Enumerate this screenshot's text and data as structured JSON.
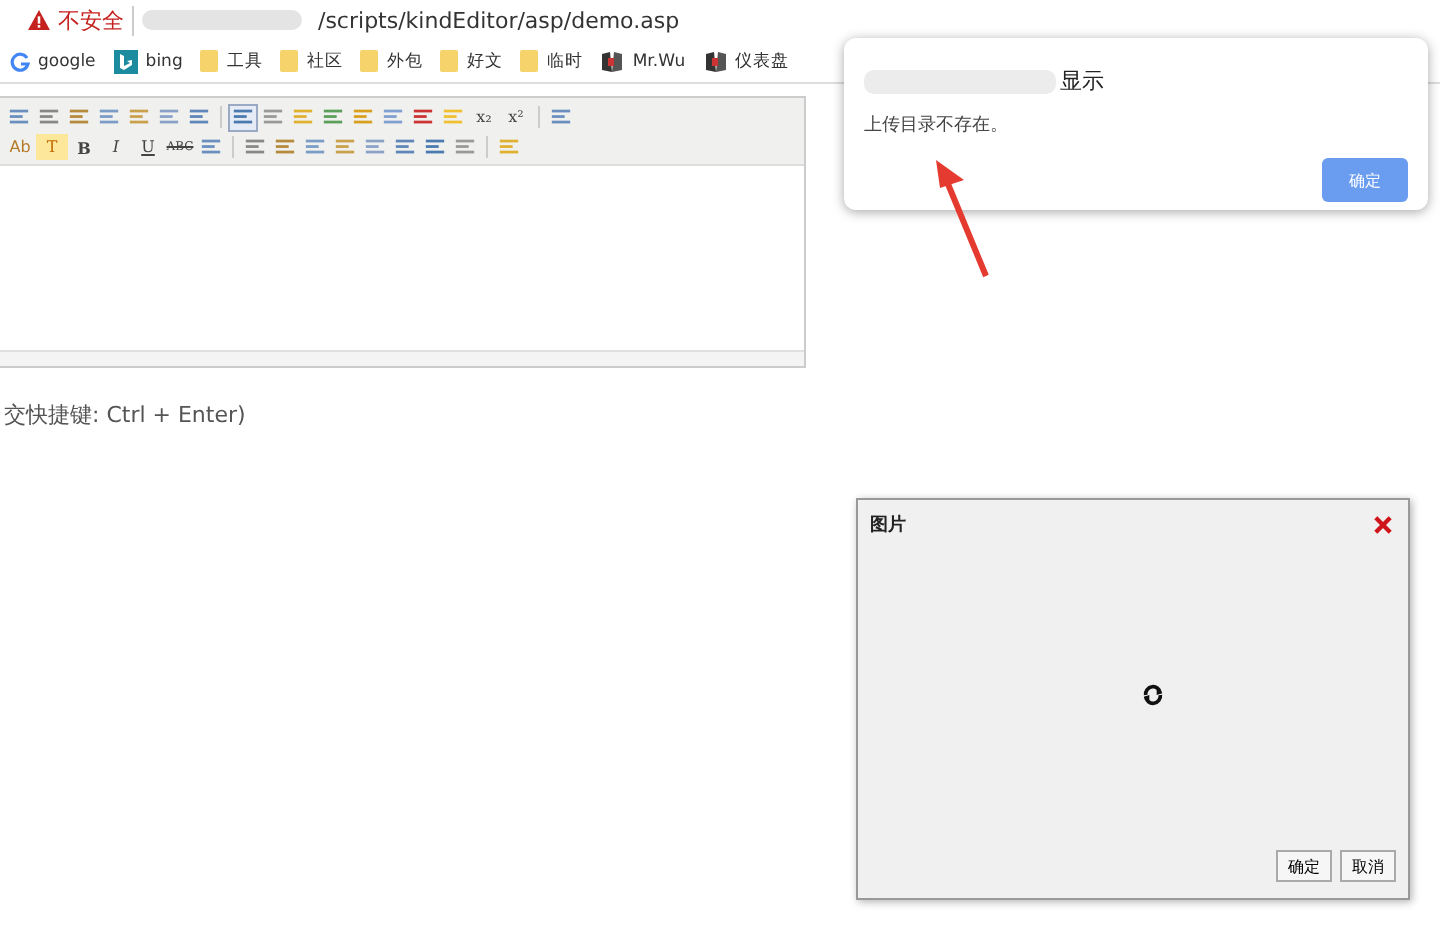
{
  "browser": {
    "security_label": "不安全",
    "address": "/scripts/kindEditor/asp/demo.asp"
  },
  "bookmarks": [
    {
      "kind": "google",
      "label": "google"
    },
    {
      "kind": "bing",
      "label": "bing"
    },
    {
      "kind": "folder",
      "label": "工具"
    },
    {
      "kind": "folder",
      "label": "社区"
    },
    {
      "kind": "folder",
      "label": "外包"
    },
    {
      "kind": "folder",
      "label": "好文"
    },
    {
      "kind": "folder",
      "label": "临时"
    },
    {
      "kind": "page",
      "label": "Mr.Wu"
    },
    {
      "kind": "page",
      "label": "仪表盘"
    }
  ],
  "editor": {
    "toolbar_rows": [
      [
        {
          "kind": "icon"
        },
        {
          "kind": "icon"
        },
        {
          "kind": "icon"
        },
        {
          "kind": "icon"
        },
        {
          "kind": "icon"
        },
        {
          "kind": "icon"
        },
        {
          "kind": "icon"
        },
        {
          "kind": "sep"
        },
        {
          "kind": "icon",
          "selected": true
        },
        {
          "kind": "icon",
          "selected": false
        },
        {
          "kind": "icon",
          "selected": false
        },
        {
          "kind": "icon",
          "selected": false
        },
        {
          "kind": "icon"
        },
        {
          "kind": "icon"
        },
        {
          "kind": "icon"
        },
        {
          "kind": "icon"
        },
        {
          "kind": "glyph",
          "label": "x₂"
        },
        {
          "kind": "glyph",
          "label": "x²"
        },
        {
          "kind": "sep"
        },
        {
          "kind": "icon"
        }
      ],
      [
        {
          "kind": "color",
          "label": "Ab"
        },
        {
          "kind": "highlight",
          "label": "T"
        },
        {
          "kind": "bold",
          "label": "B"
        },
        {
          "kind": "italic",
          "label": "I"
        },
        {
          "kind": "underline",
          "label": "U"
        },
        {
          "kind": "strike",
          "label": "ABC"
        },
        {
          "kind": "icon"
        },
        {
          "kind": "sep"
        },
        {
          "kind": "icon"
        },
        {
          "kind": "icon"
        },
        {
          "kind": "icon"
        },
        {
          "kind": "icon"
        },
        {
          "kind": "icon"
        },
        {
          "kind": "icon"
        },
        {
          "kind": "icon"
        },
        {
          "kind": "icon"
        },
        {
          "kind": "sep"
        },
        {
          "kind": "icon"
        }
      ]
    ],
    "hint": "交快捷键: Ctrl + Enter)"
  },
  "alert": {
    "title": "显示",
    "message": "上传目录不存在。",
    "button": "确定"
  },
  "image_dialog": {
    "title": "图片",
    "buttons": [
      "确定",
      "取消"
    ]
  }
}
